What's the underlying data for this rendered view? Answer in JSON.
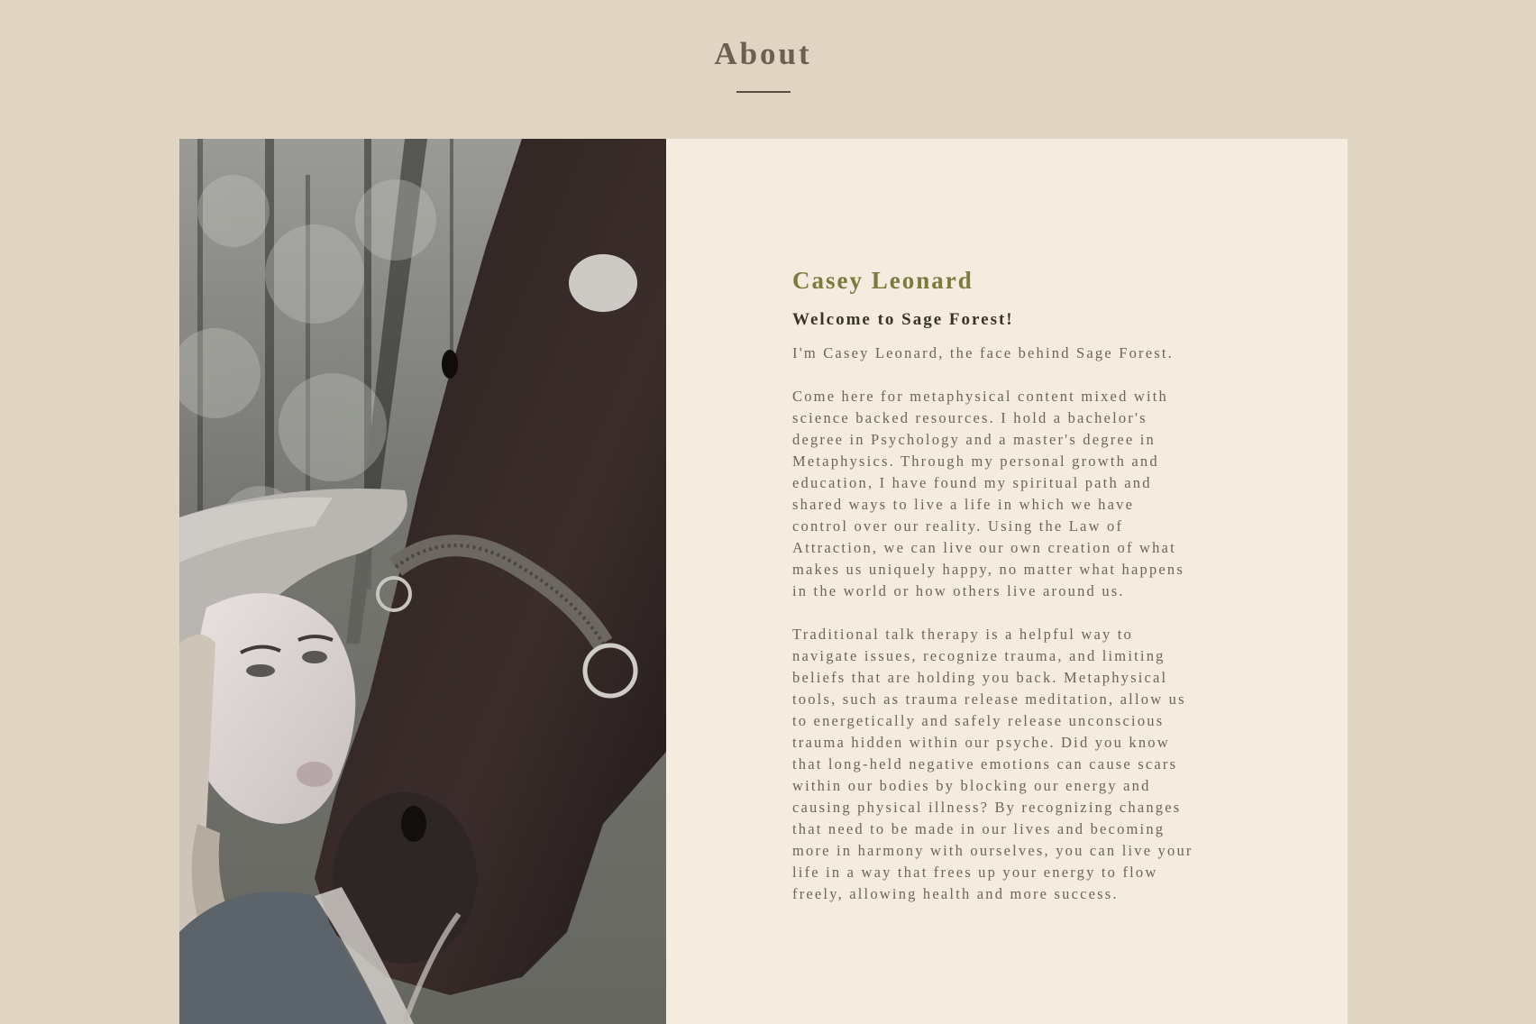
{
  "section": {
    "title": "About"
  },
  "colors": {
    "page_background": "#e0d4c3",
    "card_background": "#f5ebdf",
    "title_color": "#6b5f53",
    "name_color": "#7d7a3e",
    "body_text_color": "#6e6459"
  },
  "photo": {
    "description_icon": "photo-image"
  },
  "about": {
    "name": "Casey Leonard",
    "welcome": "Welcome to Sage Forest!",
    "intro_lines": "I'm Casey Leonard, the face behind Sage Forest.",
    "paragraph_1": "Come here for metaphysical content mixed with\nscience backed resources. I hold a bachelor's\ndegree in Psychology and a master's degree in\nMetaphysics. Through my personal growth and\neducation, I have found my spiritual path and\nshared ways to live a life in which we have\ncontrol over our reality. Using the Law of\nAttraction, we can live our own creation of what\nmakes us uniquely happy, no matter what happens\nin the world or how others live around us.",
    "paragraph_2": "Traditional talk therapy is a helpful way to\nnavigate issues, recognize trauma, and limiting\nbeliefs that are holding you back. Metaphysical\ntools, such as trauma release meditation, allow us\nto energetically and safely release unconscious\ntrauma hidden within our psyche. Did you know\nthat long-held negative emotions can cause scars\nwithin our bodies by blocking our energy and\ncausing physical illness? By recognizing changes\nthat need to be made in our lives and becoming\nmore in harmony with ourselves, you can live your\nlife in a way that frees up your energy to flow\nfreely, allowing health and more success."
  }
}
